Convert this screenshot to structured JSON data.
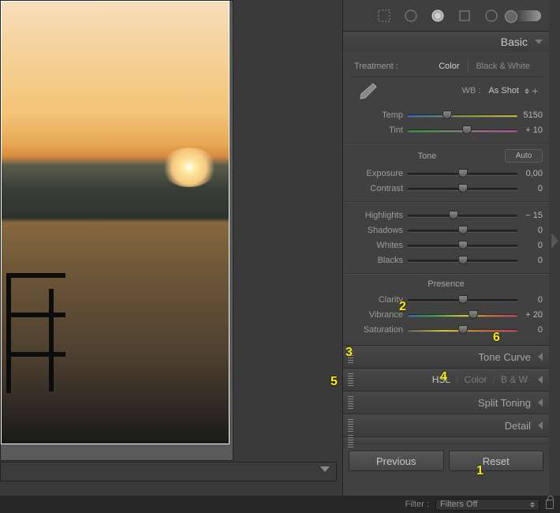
{
  "panels": {
    "basic": "Basic",
    "toneCurve": "Tone Curve",
    "hsl": {
      "a": "HSL",
      "b": "Color",
      "c": "B & W"
    },
    "splitToning": "Split Toning",
    "detail": "Detail"
  },
  "treatment": {
    "label": "Treatment :",
    "color": "Color",
    "bw": "Black & White"
  },
  "wb": {
    "label": "WB :",
    "value": "As Shot"
  },
  "sliders": {
    "temp": {
      "label": "Temp",
      "value": "5150",
      "pos": 36
    },
    "tint": {
      "label": "Tint",
      "value": "+ 10",
      "pos": 54
    },
    "exposure": {
      "label": "Exposure",
      "value": "0,00",
      "pos": 50
    },
    "contrast": {
      "label": "Contrast",
      "value": "0",
      "pos": 50
    },
    "highlights": {
      "label": "Highlights",
      "value": "− 15",
      "pos": 42
    },
    "shadows": {
      "label": "Shadows",
      "value": "0",
      "pos": 50
    },
    "whites": {
      "label": "Whites",
      "value": "0",
      "pos": 50
    },
    "blacks": {
      "label": "Blacks",
      "value": "0",
      "pos": 50
    },
    "clarity": {
      "label": "Clarity",
      "value": "0",
      "pos": 50
    },
    "vibrance": {
      "label": "Vibrance",
      "value": "+ 20",
      "pos": 60
    },
    "saturation": {
      "label": "Saturation",
      "value": "0",
      "pos": 50
    }
  },
  "sections": {
    "tone": "Tone",
    "presence": "Presence",
    "auto": "Auto"
  },
  "buttons": {
    "previous": "Previous",
    "reset": "Reset"
  },
  "filter": {
    "label": "Filter :",
    "value": "Filters Off"
  },
  "annotations": {
    "a1": "1",
    "a2": "2",
    "a3": "3",
    "a4": "4",
    "a5": "5",
    "a6": "6"
  }
}
